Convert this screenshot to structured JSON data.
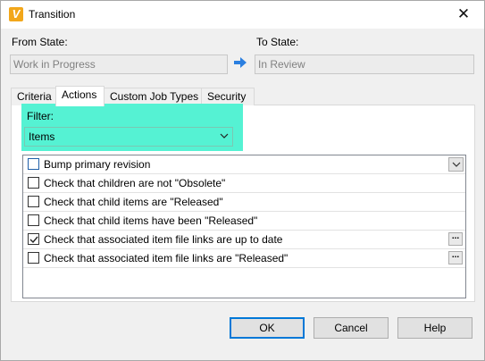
{
  "window": {
    "title": "Transition",
    "app_icon_letter": "V",
    "close_glyph": "✕"
  },
  "from_state": {
    "label": "From State:",
    "value": "Work in Progress"
  },
  "to_state": {
    "label": "To State:",
    "value": "In Review"
  },
  "tabs": [
    {
      "label": "Criteria",
      "active": false
    },
    {
      "label": "Actions",
      "active": true
    },
    {
      "label": "Custom Job Types",
      "active": false
    },
    {
      "label": "Security",
      "active": false
    }
  ],
  "filter": {
    "label": "Filter:",
    "selected": "Items"
  },
  "actions": [
    {
      "label": "Bump primary revision",
      "checked": false,
      "control": "dropdown"
    },
    {
      "label": "Check that children are not \"Obsolete\"",
      "checked": false,
      "control": "none"
    },
    {
      "label": "Check that child items are \"Released\"",
      "checked": false,
      "control": "none"
    },
    {
      "label": "Check that child items have been \"Released\"",
      "checked": false,
      "control": "none"
    },
    {
      "label": "Check that associated item file links are up to date",
      "checked": true,
      "control": "ellipsis"
    },
    {
      "label": "Check that associated item file links are \"Released\"",
      "checked": false,
      "control": "ellipsis"
    }
  ],
  "ellipsis_text": "...",
  "buttons": {
    "ok": "OK",
    "cancel": "Cancel",
    "help": "Help"
  },
  "colors": {
    "highlight": "#55f2d3",
    "arrow": "#2b7fe0",
    "primary_border": "#0078d7",
    "app_icon": "#f2a71b"
  }
}
